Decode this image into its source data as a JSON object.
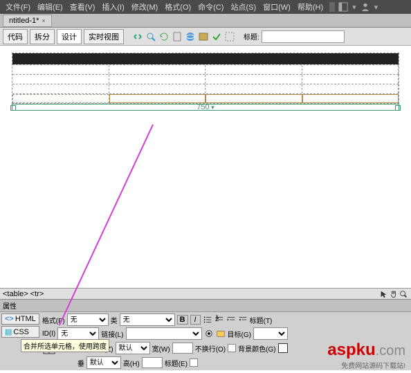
{
  "menubar": {
    "items": [
      "文件(F)",
      "编辑(E)",
      "查看(V)",
      "插入(I)",
      "修改(M)",
      "格式(O)",
      "命令(C)",
      "站点(S)",
      "窗口(W)",
      "帮助(H)"
    ]
  },
  "tab": {
    "name": "ntitled-1*",
    "close": "×"
  },
  "toolbar": {
    "views": [
      "代码",
      "拆分",
      "设计",
      "实时视图"
    ],
    "title_label": "标题:"
  },
  "ruler": {
    "width": "750"
  },
  "status": {
    "path": "<table> <tr>"
  },
  "props": {
    "panel_title": "属性",
    "html_btn": "HTML",
    "css_btn": "CSS",
    "format_label": "格式(F)",
    "format_value": "无",
    "id_label": "ID(I)",
    "id_value": "无",
    "class_label": "类",
    "class_value": "无",
    "link_label": "链接(L)",
    "bold": "B",
    "italic": "I",
    "title_btn": "标题(T)",
    "target_btn": "目标(G)",
    "cell_label": "单",
    "horiz_label": "水平(Z)",
    "horiz_value": "默认",
    "vert_label": "垂",
    "vert_value": "默认",
    "width_label": "宽(W)",
    "height_label": "高(H)",
    "nowrap_label": "不换行(O)",
    "bgcolor_label": "背景颜色(G)",
    "header_label": "标题(E)"
  },
  "tooltip": "合并所选单元格，使用跨度",
  "watermark": {
    "brand1": "asp",
    "brand2": "k",
    "brand3": "u",
    "domain": ".com",
    "sub": "免费网站源码下载站!"
  }
}
